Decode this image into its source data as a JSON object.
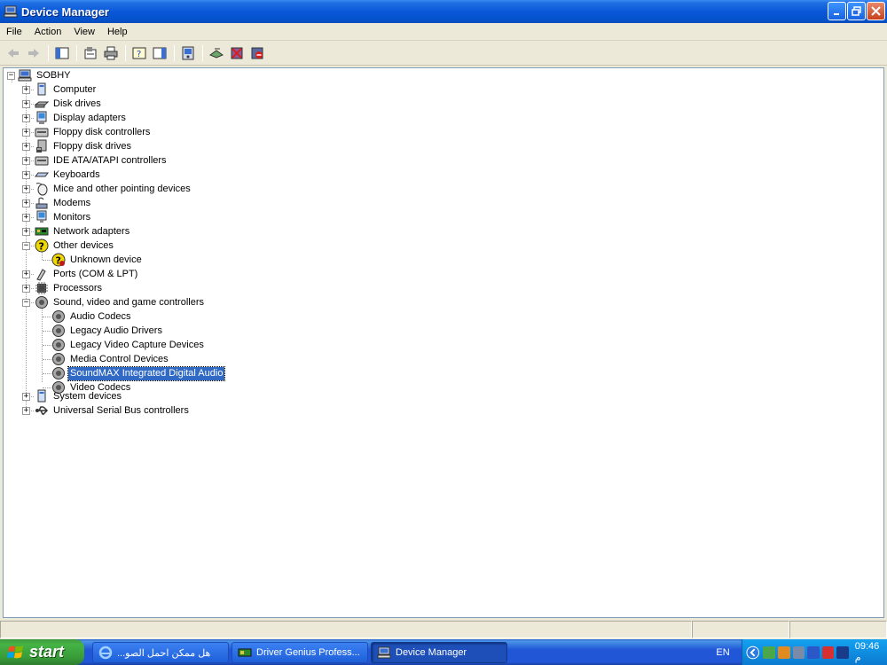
{
  "window": {
    "title": "Device Manager"
  },
  "menu": [
    "File",
    "Action",
    "View",
    "Help"
  ],
  "tree": {
    "root": "SOBHY",
    "categories": [
      "Computer",
      "Disk drives",
      "Display adapters",
      "Floppy disk controllers",
      "Floppy disk drives",
      "IDE ATA/ATAPI controllers",
      "Keyboards",
      "Mice and other pointing devices",
      "Modems",
      "Monitors",
      "Network adapters",
      "Other devices",
      "Ports (COM & LPT)",
      "Processors",
      "Sound, video and game controllers",
      "System devices",
      "Universal Serial Bus controllers"
    ],
    "other_devices_children": [
      "Unknown device"
    ],
    "sound_children": [
      "Audio Codecs",
      "Legacy Audio Drivers",
      "Legacy Video Capture Devices",
      "Media Control Devices",
      "SoundMAX Integrated Digital Audio",
      "Video Codecs"
    ],
    "selected": "SoundMAX Integrated Digital Audio"
  },
  "taskbar": {
    "start": "start",
    "tasks": [
      "هل ممكن احمل الصو...",
      "Driver Genius Profess...",
      "Device Manager"
    ],
    "active_task": "Device Manager",
    "language": "EN",
    "clock": "09:46 م"
  },
  "colors": {
    "titlebar": "#0552cc",
    "selection": "#316AC5",
    "taskbar": "#2157d7",
    "start": "#46b346"
  }
}
